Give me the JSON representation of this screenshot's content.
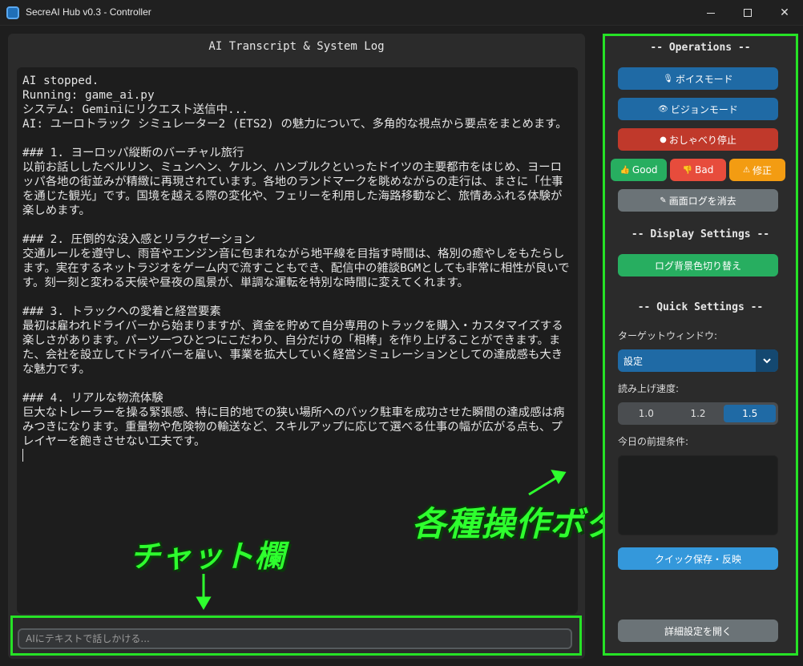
{
  "window": {
    "title": "SecreAI Hub v0.3 - Controller",
    "minimize_icon": "minimize-icon",
    "maximize_icon": "maximize-icon",
    "close_glyph": "✕"
  },
  "log": {
    "title": "AI Transcript & System Log",
    "text": "AI stopped.\nRunning: game_ai.py\nシステム: Geminiにリクエスト送信中...\nAI: ユーロトラック シミュレーター2 (ETS2) の魅力について、多角的な視点から要点をまとめます。\n\n### 1. ヨーロッパ縦断のバーチャル旅行\n以前お話ししたベルリン、ミュンヘン、ケルン、ハンブルクといったドイツの主要都市をはじめ、ヨーロッパ各地の街並みが精緻に再現されています。各地のランドマークを眺めながらの走行は、まさに「仕事を通じた観光」です。国境を越える際の変化や、フェリーを利用した海路移動など、旅情あふれる体験が楽しめます。\n\n### 2. 圧倒的な没入感とリラクゼーション\n交通ルールを遵守し、雨音やエンジン音に包まれながら地平線を目指す時間は、格別の癒やしをもたらします。実在するネットラジオをゲーム内で流すこともでき、配信中の雑談BGMとしても非常に相性が良いです。刻一刻と変わる天候や昼夜の風景が、単調な運転を特別な時間に変えてくれます。\n\n### 3. トラックへの愛着と経営要素\n最初は雇われドライバーから始まりますが、資金を貯めて自分専用のトラックを購入・カスタマイズする楽しさがあります。パーツ一つひとつにこだわり、自分だけの「相棒」を作り上げることができます。また、会社を設立してドライバーを雇い、事業を拡大していく経営シミュレーションとしての達成感も大きな魅力です。\n\n### 4. リアルな物流体験\n巨大なトレーラーを操る緊張感、特に目的地での狭い場所へのバック駐車を成功させた瞬間の達成感は病みつきになります。重量物や危険物の輸送など、スキルアップに応じて選べる仕事の幅が広がる点も、プレイヤーを飽きさせない工夫です。\n"
  },
  "chat": {
    "placeholder": "AIにテキストで話しかける..."
  },
  "annotations": {
    "chat_label": "チャット欄",
    "ops_label": "各種操作ボタン",
    "highlight_color": "#26e226"
  },
  "operations": {
    "title": "-- Operations --",
    "voice_mode": {
      "icon": "microphone-icon",
      "glyph": "🎙",
      "label": "ボイスモード"
    },
    "vision_mode": {
      "icon": "eye-icon",
      "glyph": "👁",
      "label": "ビジョンモード"
    },
    "stop_talk": {
      "icon": "record-icon",
      "glyph": "●",
      "label": "おしゃべり停止"
    },
    "good": {
      "icon": "thumbs-up-icon",
      "glyph": "👍",
      "label": "Good"
    },
    "bad": {
      "icon": "thumbs-down-icon",
      "glyph": "👎",
      "label": "Bad"
    },
    "fix": {
      "icon": "warning-icon",
      "glyph": "⚠",
      "label": "修正"
    },
    "clear_log": {
      "icon": "pencil-icon",
      "glyph": "✎",
      "label": "画面ログを消去"
    }
  },
  "display_settings": {
    "title": "-- Display Settings --",
    "toggle_bg": {
      "label": "ログ背景色切り替え"
    }
  },
  "quick_settings": {
    "title": "-- Quick Settings --",
    "target_window_label": "ターゲットウィンドウ:",
    "target_window_value": "設定",
    "read_speed_label": "読み上げ速度:",
    "speed_options": [
      "1.0",
      "1.2",
      "1.5"
    ],
    "speed_selected": "1.5",
    "premise_label": "今日の前提条件:",
    "quick_save": {
      "label": "クイック保存・反映"
    },
    "open_advanced": {
      "label": "詳細設定を開く"
    }
  },
  "colors": {
    "accent_blue": "#1f6aa5",
    "red": "#c0392b",
    "green": "#27ae60",
    "orange": "#f39c12",
    "gray": "#6b7377"
  }
}
